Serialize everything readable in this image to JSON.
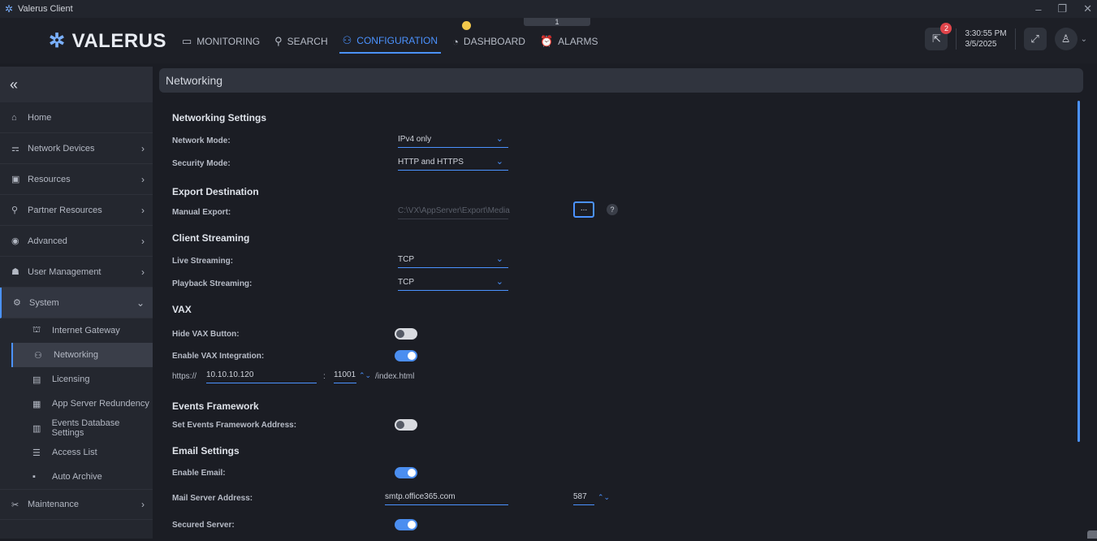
{
  "window": {
    "title": "Valerus Client"
  },
  "brand": {
    "logo": "VALERUS"
  },
  "nav": [
    {
      "label": "MONITORING",
      "icon": "monitor-icon"
    },
    {
      "label": "SEARCH",
      "icon": "search-icon"
    },
    {
      "label": "CONFIGURATION",
      "icon": "configuration-icon"
    },
    {
      "label": "DASHBOARD",
      "icon": "dashboard-icon"
    },
    {
      "label": "ALARMS",
      "icon": "alarm-icon"
    }
  ],
  "tab_number": "1",
  "header": {
    "notification_count": "2",
    "time": "3:30:55 PM",
    "date": "3/5/2025"
  },
  "sidebar": {
    "items": [
      {
        "label": "Home"
      },
      {
        "label": "Network Devices"
      },
      {
        "label": "Resources"
      },
      {
        "label": "Partner Resources"
      },
      {
        "label": "Advanced"
      },
      {
        "label": "User Management"
      },
      {
        "label": "System"
      }
    ],
    "system_sub": [
      {
        "label": "Internet Gateway"
      },
      {
        "label": "Networking"
      },
      {
        "label": "Licensing"
      },
      {
        "label": "App Server Redundency"
      },
      {
        "label": "Events Database Settings"
      },
      {
        "label": "Access List"
      },
      {
        "label": "Auto Archive"
      }
    ],
    "maintenance": {
      "label": "Maintenance"
    }
  },
  "page": {
    "title": "Networking",
    "networking_settings": {
      "title": "Networking Settings",
      "network_mode_label": "Network Mode:",
      "network_mode_value": "IPv4 only",
      "security_mode_label": "Security Mode:",
      "security_mode_value": "HTTP and HTTPS"
    },
    "export": {
      "title": "Export Destination",
      "manual_label": "Manual Export:",
      "manual_value": "C:\\VX\\AppServer\\Export\\Media",
      "browse_label": "...",
      "help_label": "?"
    },
    "client_streaming": {
      "title": "Client Streaming",
      "live_label": "Live Streaming:",
      "live_value": "TCP",
      "playback_label": "Playback Streaming:",
      "playback_value": "TCP"
    },
    "vax": {
      "title": "VAX",
      "hide_label": "Hide VAX Button:",
      "hide_on": false,
      "enable_label": "Enable VAX Integration:",
      "enable_on": true,
      "protocol": "https://",
      "host": "10.10.10.120",
      "colon": ":",
      "port": "11001",
      "path": "/index.html"
    },
    "events_framework": {
      "title": "Events Framework",
      "set_label": "Set Events Framework Address:",
      "set_on": false
    },
    "email": {
      "title": "Email Settings",
      "enable_label": "Enable Email:",
      "enable_on": true,
      "server_label": "Mail Server Address:",
      "server_value": "smtp.office365.com",
      "port": "587",
      "secured_label": "Secured Server:",
      "secured_on": true
    }
  },
  "colors": {
    "accent": "#4b92ff",
    "badge": "#e0444a",
    "notif_dot": "#f3c84b"
  }
}
